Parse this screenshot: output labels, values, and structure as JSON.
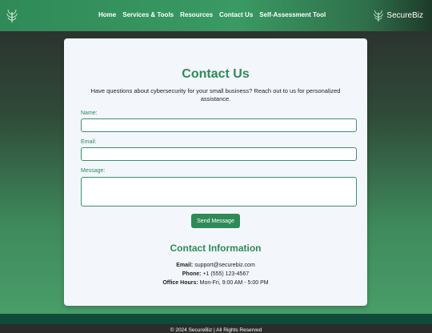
{
  "nav": {
    "links": [
      "Home",
      "Services & Tools",
      "Resources",
      "Contact Us",
      "Self-Assessment Tool"
    ],
    "brand": "SecureBiz"
  },
  "contact": {
    "title": "Contact Us",
    "intro": "Have questions about cybersecurity for your small business? Reach out to us for personalized assistance.",
    "name_label": "Name:",
    "email_label": "Email:",
    "message_label": "Message:",
    "name_value": "",
    "email_value": "",
    "message_value": "",
    "send_label": "Send Message"
  },
  "info": {
    "title": "Contact Information",
    "email_label": "Email:",
    "email": "support@securebiz.com",
    "phone_label": "Phone:",
    "phone": "+1 (555) 123-4567",
    "hours_label": "Office Hours:",
    "hours": "Mon-Fri, 9:00 AM - 5:00 PM"
  },
  "footer": {
    "text": "© 2024 SecureBiz | All Rights Reserved"
  },
  "colors": {
    "accent": "#2e8b57",
    "footer": "#0f4a3a"
  }
}
